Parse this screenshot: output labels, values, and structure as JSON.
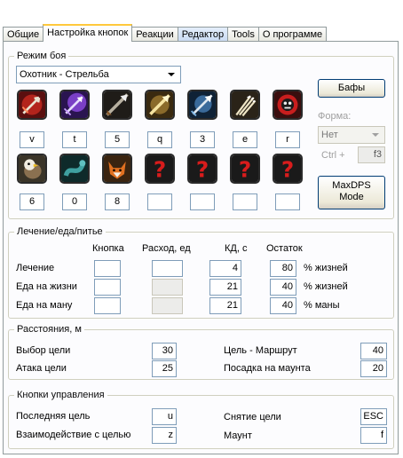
{
  "tabs": [
    {
      "label": "Общие"
    },
    {
      "label": "Настройка кнопок"
    },
    {
      "label": "Реакции"
    },
    {
      "label": "Редактор"
    },
    {
      "label": "Tools"
    },
    {
      "label": "О программе"
    }
  ],
  "combat": {
    "title": "Режим боя",
    "mode": "Охотник - Стрельба",
    "buffs_button": "Бафы",
    "form_label": "Форма:",
    "form_value": "Нет",
    "ctrl_label": "Ctrl +",
    "ctrl_key": "f3",
    "maxdps_line1": "MaxDPS",
    "maxdps_line2": "Mode",
    "row1_keys": [
      "v",
      "t",
      "5",
      "q",
      "3",
      "e",
      "r"
    ],
    "row2_keys": [
      "6",
      "0",
      "8",
      "",
      "",
      "",
      ""
    ],
    "row1_icons": [
      "arrow-strike-icon",
      "purple-arrow-icon",
      "piercing-arrow-icon",
      "golden-arrow-icon",
      "blue-arrow-icon",
      "multi-shot-icon",
      "skull-mark-icon"
    ],
    "row2_icons": [
      "eagle-icon",
      "serpent-icon",
      "fox-icon",
      "question-mark-icon",
      "question-mark-icon",
      "question-mark-icon",
      "question-mark-icon"
    ]
  },
  "heal": {
    "title": "Лечение/еда/питье",
    "col_key": "Кнопка",
    "col_consume": "Расход, ед",
    "col_cd": "КД, с",
    "col_rest": "Остаток",
    "rows": [
      {
        "label": "Лечение",
        "key": "",
        "consume": "",
        "cd": "4",
        "rest": "80",
        "unit": "% жизней"
      },
      {
        "label": "Еда на жизни",
        "key": "",
        "consume": "",
        "cd": "21",
        "rest": "40",
        "unit": "% жизней"
      },
      {
        "label": "Еда на ману",
        "key": "",
        "consume": "",
        "cd": "21",
        "rest": "40",
        "unit": "% маны"
      }
    ]
  },
  "dist": {
    "title": "Расстояния, м",
    "target_select_label": "Выбор цели",
    "target_select_value": "30",
    "attack_label": "Атака цели",
    "attack_value": "25",
    "route_label": "Цель - Маршрут",
    "route_value": "40",
    "mount_label": "Посадка на маунта",
    "mount_value": "20"
  },
  "controls": {
    "title": "Кнопки управления",
    "last_target_label": "Последняя цель",
    "last_target_key": "u",
    "interact_label": "Взаимодействие с целью",
    "interact_key": "z",
    "clear_target_label": "Снятие цели",
    "clear_target_key": "ESC",
    "mount_label": "Маунт",
    "mount_key": "f"
  }
}
